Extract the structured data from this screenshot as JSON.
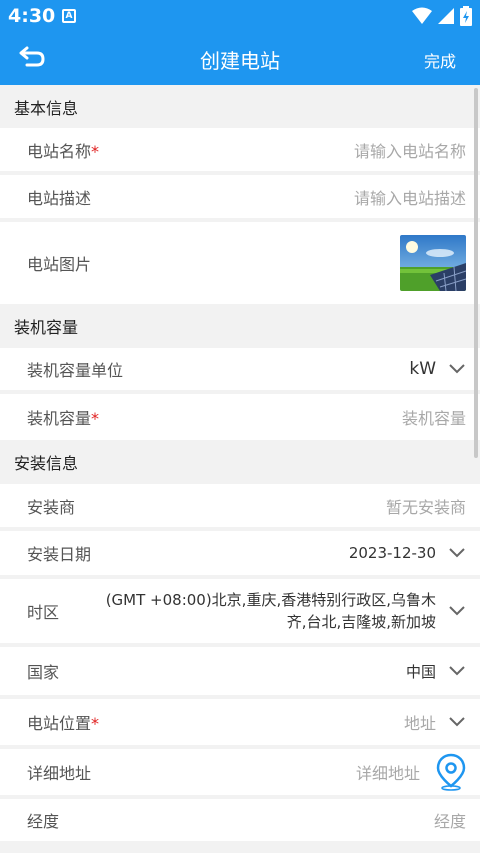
{
  "status": {
    "time": "4:30",
    "a_icon": "A"
  },
  "appbar": {
    "title": "创建电站",
    "done": "完成"
  },
  "sections": {
    "basic": "基本信息",
    "capacity": "装机容量",
    "install": "安装信息"
  },
  "fields": {
    "name": {
      "label": "电站名称",
      "placeholder": "请输入电站名称"
    },
    "desc": {
      "label": "电站描述",
      "placeholder": "请输入电站描述"
    },
    "photo": {
      "label": "电站图片"
    },
    "unit": {
      "label": "装机容量单位",
      "value": "kW"
    },
    "capacity": {
      "label": "装机容量",
      "placeholder": "装机容量"
    },
    "installer": {
      "label": "安装商",
      "placeholder": "暂无安装商"
    },
    "date": {
      "label": "安装日期",
      "value": "2023-12-30"
    },
    "timezone": {
      "label": "时区",
      "value": "(GMT +08:00)北京,重庆,香港特别行政区,乌鲁木齐,台北,吉隆坡,新加坡"
    },
    "country": {
      "label": "国家",
      "value": "中国"
    },
    "location": {
      "label": "电站位置",
      "placeholder": "地址"
    },
    "address": {
      "label": "详细地址",
      "placeholder": "详细地址"
    },
    "longitude": {
      "label": "经度",
      "placeholder": "经度"
    }
  },
  "required_mark": "*",
  "colors": {
    "primary": "#1e96f0",
    "required": "#e02020"
  },
  "icons": [
    "back-arrow-icon",
    "chevron-down-icon",
    "location-pin-icon",
    "wifi-icon",
    "battery-icon"
  ]
}
